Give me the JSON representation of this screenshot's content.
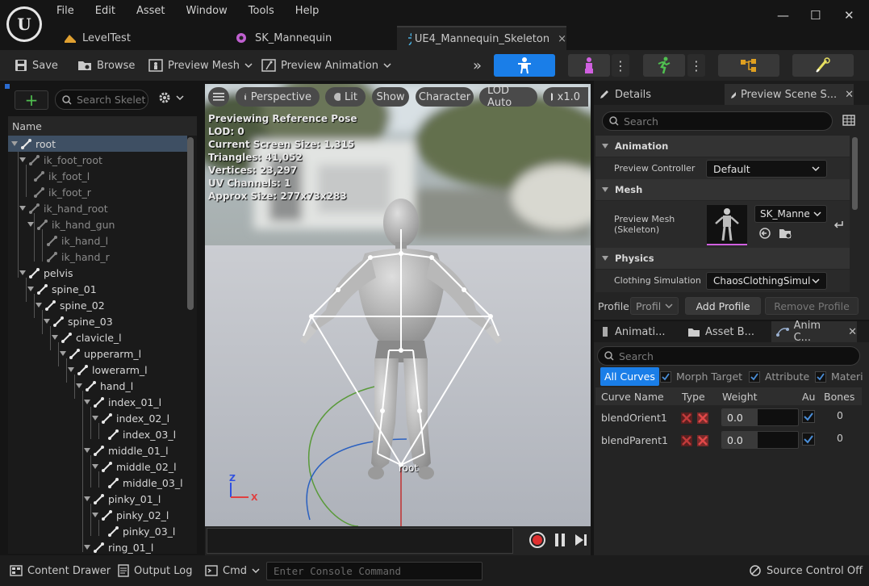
{
  "menu": [
    "File",
    "Edit",
    "Asset",
    "Window",
    "Tools",
    "Help"
  ],
  "tabs": [
    {
      "label": "LevelTest"
    },
    {
      "label": "SK_Mannequin"
    },
    {
      "label": "UE4_Mannequin_Skeleton",
      "close": "×"
    }
  ],
  "window_controls": {
    "minimize": "—",
    "maximize": "☐",
    "close": "✕"
  },
  "toolbar": {
    "save": "Save",
    "browse": "Browse",
    "preview_mesh": "Preview Mesh",
    "preview_animation": "Preview Animation",
    "more": "»"
  },
  "skeleton_tree": {
    "add": "+",
    "search_placeholder": "Search Skeleton",
    "column": "Name",
    "bones": [
      {
        "name": "root"
      },
      {
        "name": "ik_foot_root"
      },
      {
        "name": "ik_foot_l"
      },
      {
        "name": "ik_foot_r"
      },
      {
        "name": "ik_hand_root"
      },
      {
        "name": "ik_hand_gun"
      },
      {
        "name": "ik_hand_l"
      },
      {
        "name": "ik_hand_r"
      },
      {
        "name": "pelvis"
      },
      {
        "name": "spine_01"
      },
      {
        "name": "spine_02"
      },
      {
        "name": "spine_03"
      },
      {
        "name": "clavicle_l"
      },
      {
        "name": "upperarm_l"
      },
      {
        "name": "lowerarm_l"
      },
      {
        "name": "hand_l"
      },
      {
        "name": "index_01_l"
      },
      {
        "name": "index_02_l"
      },
      {
        "name": "index_03_l"
      },
      {
        "name": "middle_01_l"
      },
      {
        "name": "middle_02_l"
      },
      {
        "name": "middle_03_l"
      },
      {
        "name": "pinky_01_l"
      },
      {
        "name": "pinky_02_l"
      },
      {
        "name": "pinky_03_l"
      },
      {
        "name": "ring_01_l"
      }
    ]
  },
  "viewport": {
    "perspective": "Perspective",
    "lit": "Lit",
    "show": "Show",
    "character": "Character",
    "lod": "LOD Auto",
    "speed": "x1.0",
    "stats": [
      "Previewing Reference Pose",
      "LOD: 0",
      "Current Screen Size: 1.315",
      "Triangles: 41,052",
      "Vertices: 23,297",
      "UV Channels: 1",
      "Approx Size: 277x73x283"
    ],
    "root_label": "root",
    "axis": {
      "z": "Z",
      "x": "X"
    }
  },
  "details": {
    "tab_details": "Details",
    "tab_preview": "Preview Scene S...",
    "search_placeholder": "Search",
    "animation_section": "Animation",
    "preview_controller_label": "Preview Controller",
    "preview_controller_value": "Default",
    "mesh_section": "Mesh",
    "preview_mesh_label": "Preview Mesh (Skeleton)",
    "preview_mesh_value": "SK_Manne",
    "physics_section": "Physics",
    "clothing_label": "Clothing Simulation",
    "clothing_value": "ChaosClothingSimul",
    "profile_label": "Profile",
    "profile_value": "Profil",
    "add_profile": "Add Profile",
    "remove_profile": "Remove Profile"
  },
  "curves": {
    "tab_animation": "Animati...",
    "tab_asset": "Asset B...",
    "tab_anim_curves": "Anim C...",
    "search_placeholder": "Search",
    "filters": [
      "All Curves",
      "Morph Target",
      "Attribute",
      "Materi"
    ],
    "columns": [
      "Curve Name",
      "Type",
      "Weight",
      "Au",
      "Bones"
    ],
    "rows": [
      {
        "name": "blendOrient1",
        "weight": "0.0",
        "bones": "0"
      },
      {
        "name": "blendParent1",
        "weight": "0.0",
        "bones": "0"
      }
    ]
  },
  "bottom": {
    "content_drawer": "Content Drawer",
    "output_log": "Output Log",
    "cmd": "Cmd",
    "console_placeholder": "Enter Console Command",
    "source_control": "Source Control Off"
  },
  "colors": {
    "accent_blue": "#1a7ee8",
    "bone_white": "#ffffff",
    "axis_x": "#e04040",
    "axis_z": "#3050e0"
  }
}
